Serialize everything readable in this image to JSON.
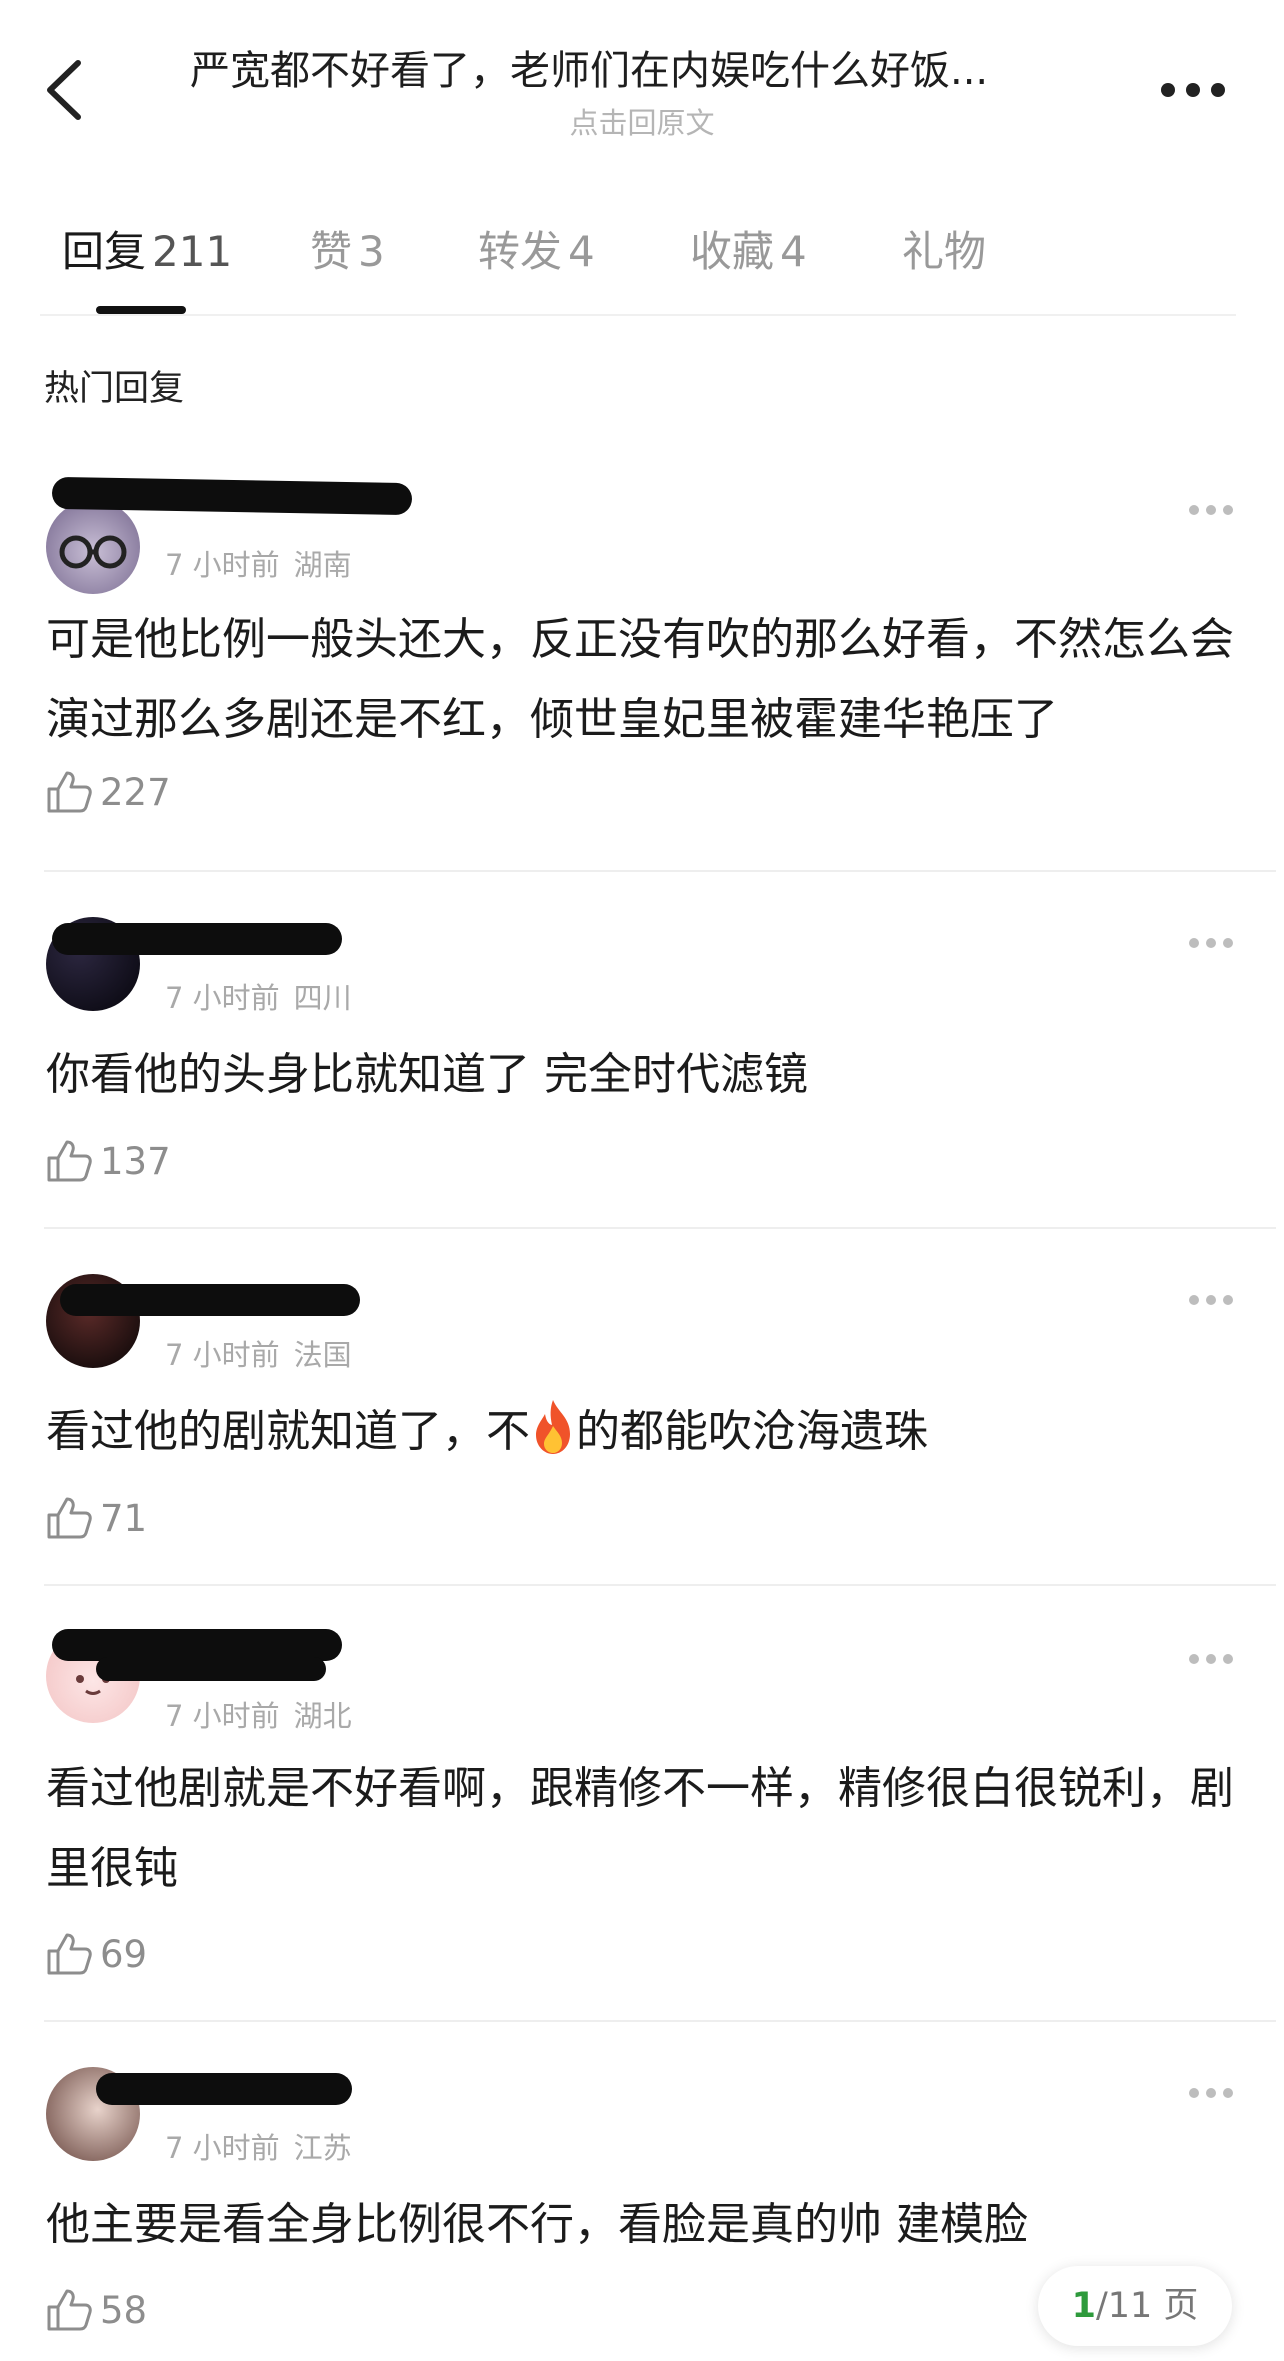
{
  "header": {
    "title": "严宽都不好看了，老师们在内娱吃什么好饭...",
    "subtitle": "点击回原文"
  },
  "tabs": [
    {
      "label": "回复",
      "count": "211"
    },
    {
      "label": "赞",
      "count": "3"
    },
    {
      "label": "转发",
      "count": "4"
    },
    {
      "label": "收藏",
      "count": "4"
    },
    {
      "label": "礼物",
      "count": ""
    }
  ],
  "section_title": "热门回复",
  "comments": [
    {
      "time": "7 小时前",
      "location": "湖南",
      "text": "可是他比例一般头还大，反正没有吹的那么好看，不然怎么会演过那么多剧还是不红，倾世皇妃里被霍建华艳压了",
      "likes": "227"
    },
    {
      "time": "7 小时前",
      "location": "四川",
      "text": "你看他的头身比就知道了 完全时代滤镜",
      "likes": "137"
    },
    {
      "time": "7 小时前",
      "location": "法国",
      "text_before": "看过他的剧就知道了，不",
      "text_after": "的都能吹沧海遗珠",
      "likes": "71"
    },
    {
      "time": "7 小时前",
      "location": "湖北",
      "text": "看过他剧就是不好看啊，跟精修不一样，精修很白很锐利，剧里很钝",
      "likes": "69"
    },
    {
      "time": "7 小时前",
      "location": "江苏",
      "text": "他主要是看全身比例很不行，看脸是真的帅 建模脸",
      "likes": "58"
    }
  ],
  "pager": {
    "current": "1",
    "total": "/11 页"
  },
  "icons": {
    "back": "chevron-left-icon",
    "more": "more-dots-icon",
    "like": "thumbs-up-icon",
    "fire": "fire-emoji"
  },
  "colors": {
    "pager_current": "#2e9a3c",
    "muted": "#a9a9a9"
  }
}
